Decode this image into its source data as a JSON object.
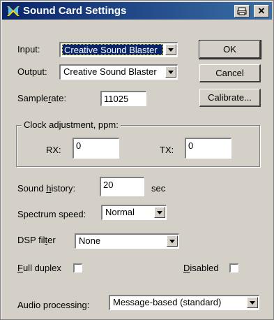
{
  "window": {
    "title": "Sound Card Settings"
  },
  "labels": {
    "input": "Input:",
    "output": "Output:",
    "samplerate": "Samplerate:",
    "clock_group": "Clock adjustment, ppm:",
    "rx": "RX:",
    "tx": "TX:",
    "sound_history": "Sound history:",
    "sec": "sec",
    "spectrum_speed": "Spectrum speed:",
    "dsp_filter": "DSP filter",
    "full_duplex": "Full duplex",
    "disabled": "Disabled",
    "audio_processing": "Audio processing:"
  },
  "values": {
    "input": "Creative Sound Blaster",
    "output": "Creative Sound Blaster",
    "samplerate": "11025",
    "rx": "0",
    "tx": "0",
    "sound_history": "20",
    "spectrum_speed": "Normal",
    "dsp_filter": "None",
    "audio_processing": "Message-based (standard)"
  },
  "buttons": {
    "ok": "OK",
    "cancel": "Cancel",
    "calibrate": "Calibrate..."
  },
  "checks": {
    "full_duplex": false,
    "disabled": false
  },
  "colors": {
    "titlebar": "#0a246a",
    "face": "#d4d0c8",
    "selection": "#0a246a"
  }
}
